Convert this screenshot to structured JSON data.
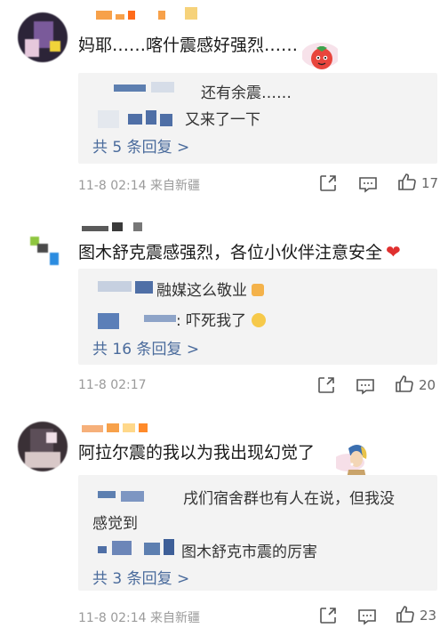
{
  "comments": [
    {
      "text": "妈耶……喀什震感好强烈……",
      "replies": [
        {
          "text": "还有余震……"
        },
        {
          "text": "又来了一下"
        }
      ],
      "more_replies": "共 5 条回复 >",
      "time": "11-8 02:14",
      "source": "来自新疆",
      "likes": "17"
    },
    {
      "text": "图木舒克震感强烈，各位小伙伴注意安全",
      "replies": [
        {
          "text": "融媒这么敬业"
        },
        {
          "text": ": 吓死我了"
        }
      ],
      "more_replies": "共 16 条回复 >",
      "time": "11-8 02:17",
      "source": "",
      "likes": "20"
    },
    {
      "text": "阿拉尔震的我以为我出现幻觉了",
      "replies": [
        {
          "text": "戌们宿舍群也有人在说，但我没"
        },
        {
          "text": "感觉到"
        },
        {
          "text": "图木舒克市震的厉害"
        }
      ],
      "more_replies": "共 3 条回复 >",
      "time": "11-8 02:14",
      "source": "来自新疆",
      "likes": "23"
    }
  ],
  "icons": {
    "share": "share-icon",
    "comment": "comment-icon",
    "like": "thumbs-up-icon",
    "heart": "heart-emoji-icon"
  },
  "colors": {
    "link": "#4a6b9c",
    "meta": "#9a9a9a",
    "reply_bg": "#f3f3f3",
    "heart": "#e0302f"
  }
}
